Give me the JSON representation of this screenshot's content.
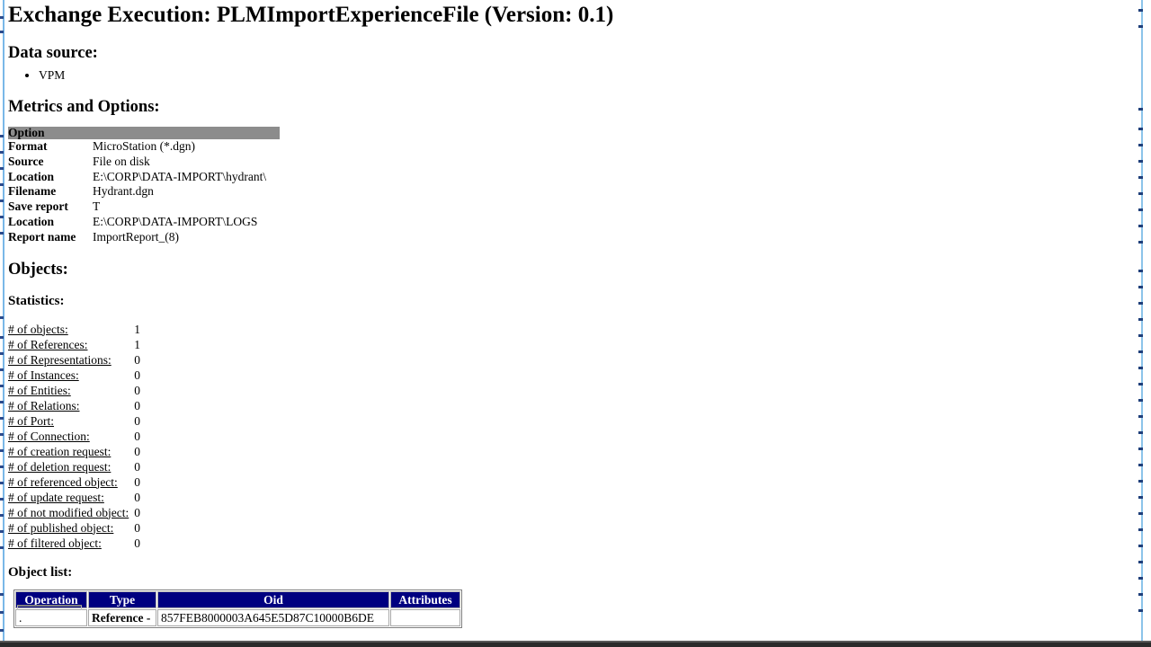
{
  "document": {
    "title": "Exchange Execution: PLMImportExperienceFile (Version: 0.1)"
  },
  "data_source": {
    "heading": "Data source:",
    "items": [
      "VPM"
    ]
  },
  "metrics": {
    "heading": "Metrics and Options:",
    "table": {
      "header": {
        "key": "Option",
        "value": ""
      },
      "rows": [
        {
          "key": "Format",
          "value": "MicroStation (*.dgn)"
        },
        {
          "key": "Source",
          "value": "File on disk"
        },
        {
          "key": "Location",
          "value": "E:\\CORP\\DATA-IMPORT\\hydrant\\"
        },
        {
          "key": "Filename",
          "value": "Hydrant.dgn"
        },
        {
          "key": "Save report",
          "value": "T"
        },
        {
          "key": "Location",
          "value": "E:\\CORP\\DATA-IMPORT\\LOGS"
        },
        {
          "key": "Report name",
          "value": "ImportReport_(8)"
        }
      ]
    }
  },
  "objects": {
    "heading": "Objects:"
  },
  "statistics": {
    "heading": "Statistics:",
    "rows": [
      {
        "label": "# of objects:",
        "value": "1"
      },
      {
        "label": "# of References:",
        "value": "1"
      },
      {
        "label": "# of Representations:",
        "value": "0"
      },
      {
        "label": "# of Instances:",
        "value": "0"
      },
      {
        "label": "# of Entities:",
        "value": "0"
      },
      {
        "label": "# of Relations:",
        "value": "0"
      },
      {
        "label": "# of Port:",
        "value": "0"
      },
      {
        "label": "# of Connection:",
        "value": "0"
      },
      {
        "label": "# of creation request:",
        "value": "0"
      },
      {
        "label": "# of deletion request:",
        "value": "0"
      },
      {
        "label": "# of referenced object:",
        "value": "0"
      },
      {
        "label": "# of update request:",
        "value": "0"
      },
      {
        "label": "# of not modified object:",
        "value": "0"
      },
      {
        "label": "# of published object:",
        "value": "0"
      },
      {
        "label": "# of filtered object:",
        "value": "0"
      }
    ]
  },
  "object_list": {
    "heading": "Object list:",
    "columns": [
      "Operation",
      "Type",
      "Oid",
      "Attributes"
    ],
    "rows": [
      {
        "operation": ".",
        "type": "Reference -",
        "oid": "857FEB8000003A645E5D87C10000B6DE",
        "attributes": ""
      }
    ]
  },
  "colors": {
    "header_band": "#8c8c8c",
    "table_header": "#000080",
    "table_header_text": "#ffffff",
    "rail_accent": "#7ab8e8",
    "minimap_accent": "#8cc4ea",
    "minimap_mark": "#1f3f7a",
    "bottom_bar": "#2b2b2b",
    "page_background": "#ffffff"
  }
}
